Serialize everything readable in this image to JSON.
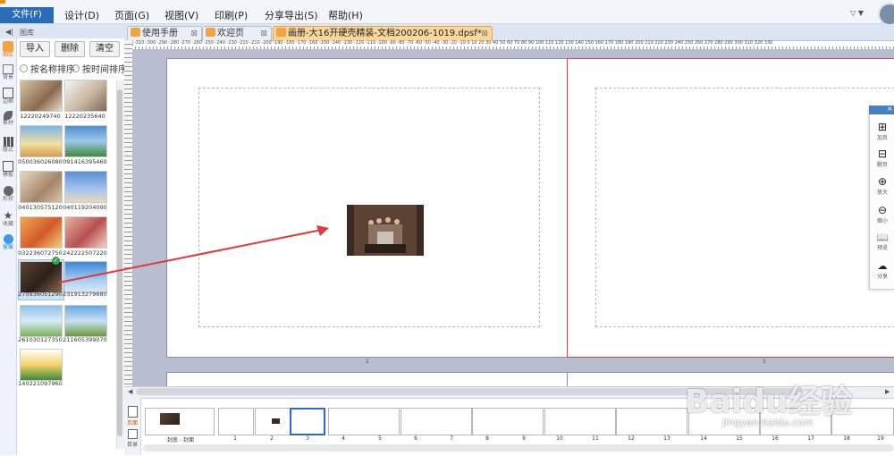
{
  "menu": {
    "items": [
      "文件(F)",
      "设计(D)",
      "页面(G)",
      "视图(V)",
      "印刷(P)",
      "分享导出(S)",
      "帮助(H)"
    ],
    "active": "文件(F)"
  },
  "window": {
    "controls": "▽ ▼"
  },
  "tabs": [
    {
      "label": "使用手册",
      "active": false
    },
    {
      "label": "欢迎页",
      "active": false
    },
    {
      "label": "画册-大16开硬壳精装-文档200206-1019.dpsf*",
      "active": true
    }
  ],
  "rail": {
    "collapse": "◀|",
    "items": [
      "图库",
      "背景",
      "边框",
      "素材",
      "版式",
      "模板",
      "形状",
      "收藏",
      "留痕"
    ]
  },
  "panel": {
    "title": "图库",
    "buttons": {
      "import": "导入",
      "delete": "删除",
      "clear": "清空"
    },
    "sort": {
      "by_name": "按名称排序",
      "by_time": "按时间排序"
    },
    "images": [
      "12220249740",
      "12220235640",
      "050036026080",
      "091416395460",
      "040130575120",
      "040119204090",
      "032236072750",
      "242222507220",
      "270936051290",
      "231913279680",
      "261030127350",
      "211605399070",
      "140221097960"
    ],
    "selected_image": "270936051290"
  },
  "ruler": {
    "h_labels": "-310 -300 -290 -280 -270 -260 -250 -240 -230 -220 -210 -200 -190 -180 -170 -160 -150 -140 -130 -120 -110 -100 -90 -80 -70 -60 -50 -40 -30 -20 -10 0 10 20 30 40 50 60 70 80 90 100 110 120 130 140 150 160 170 180 190 200 210 220 230 240 250 260 270 280 290 300 310 320 330"
  },
  "canvas": {
    "left_page_number": "2",
    "right_page_number": "3"
  },
  "float_toolbar": {
    "close": "×",
    "items": [
      {
        "icon": "add-page-icon",
        "glyph": "⊞",
        "label": "加页"
      },
      {
        "icon": "delete-page-icon",
        "glyph": "⊟",
        "label": "删页"
      },
      {
        "icon": "zoom-in-icon",
        "glyph": "⊕",
        "label": "放大"
      },
      {
        "icon": "zoom-out-icon",
        "glyph": "⊖",
        "label": "缩小"
      },
      {
        "icon": "preview-icon",
        "glyph": "📖",
        "label": "预览"
      },
      {
        "icon": "share-icon",
        "glyph": "☁",
        "label": "分享"
      }
    ]
  },
  "filmstrip": {
    "rail": [
      "页面",
      "目录"
    ],
    "pages": [
      "封底 - 封面",
      "1",
      "2",
      "3",
      "4",
      "5",
      "6",
      "7",
      "8",
      "9",
      "10",
      "11",
      "12",
      "13",
      "14",
      "15",
      "16",
      "17",
      "18",
      "19"
    ],
    "selected": "3"
  },
  "watermark": {
    "main": "Baidu经验",
    "sub": "jingyan.baidu.com"
  },
  "colors": {
    "accent": "#2b6cb8",
    "active_tab": "#fbd79b",
    "arrow": "#e03a3a",
    "selection": "#2c6cc4"
  }
}
